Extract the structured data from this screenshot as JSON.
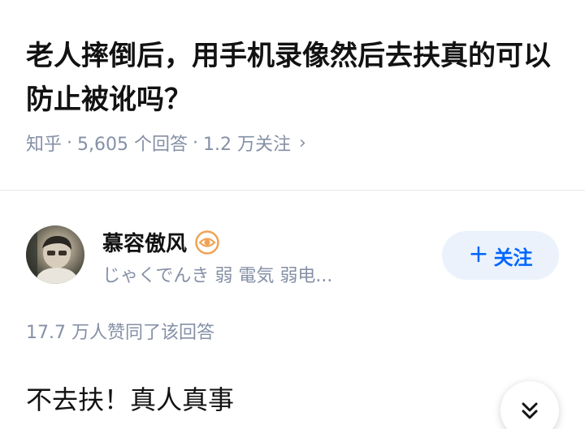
{
  "question": {
    "title": "老人摔倒后，用手机录像然后去扶真的可以防止被讹吗？",
    "source": "知乎",
    "answers_count": "5,605 个回答",
    "followers": "1.2 万关注",
    "separator": "·",
    "chevron": "›"
  },
  "author": {
    "name": "慕容傲风",
    "bio": "じゃくでんき 弱 電気 弱电...",
    "badge_icon": "eye-badge-icon",
    "avatar_icon": "avatar"
  },
  "follow_button": {
    "plus": "+",
    "label": "关注"
  },
  "answer": {
    "votes": "17.7 万人赞同了该回答",
    "first_line": "不去扶！真人真事"
  },
  "scroll_button": {
    "icon": "double-chevron-down-icon"
  },
  "colors": {
    "accent": "#0066ff",
    "accent_bg": "#ebf2fc",
    "muted": "#8590a6",
    "badge": "#f0a254"
  }
}
